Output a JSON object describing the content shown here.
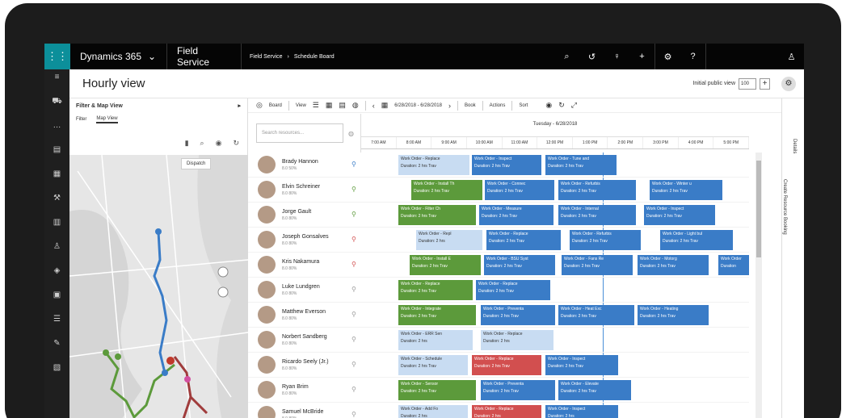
{
  "nav": {
    "brand": "Dynamics 365",
    "app": "Field Service",
    "breadcrumb": [
      "Field Service",
      "Schedule Board"
    ]
  },
  "page": {
    "title": "Hourly view",
    "zoom_label": "Initial public view",
    "zoom_value": "100"
  },
  "filter_panel": {
    "title": "Filter & Map View",
    "tabs": [
      "Filter",
      "Map View"
    ],
    "dispatch_label": "Dispatch"
  },
  "toolbar": {
    "board_label": "Board",
    "view_label": "View",
    "date_range": "6/28/2018 - 6/28/2018",
    "book_label": "Book",
    "actions_label": "Actions",
    "sort_label": "Sort"
  },
  "search": {
    "placeholder": "Search resources..."
  },
  "schedule": {
    "date_label": "Tuesday - 6/28/2018",
    "hours": [
      "7:00 AM",
      "8:00 AM",
      "9:00 AM",
      "10:00 AM",
      "11:00 AM",
      "12:00 PM",
      "1:00 PM",
      "2:00 PM",
      "3:00 PM",
      "4:00 PM",
      "5:00 PM"
    ]
  },
  "side": {
    "details": "Details",
    "create_booking": "Create Resource Booking"
  },
  "resources": [
    {
      "name": "Brady Hannon",
      "meta": "8.0  50%",
      "pin_color": "#3a7cc7",
      "bookings": [
        {
          "label": "Work Order - Replace",
          "duration": "Duration: 2 hrs Trav",
          "color": "light"
        },
        {
          "label": "Work Order - Inspect",
          "duration": "Duration: 2 hrs Trav",
          "color": "blue"
        },
        {
          "label": "Work Order - Tune and",
          "duration": "Duration: 2 hrs Trav",
          "color": "blue"
        }
      ]
    },
    {
      "name": "Elvin Schreiner",
      "meta": "8.0  80%",
      "pin_color": "#5c9a3b",
      "bookings": [
        {
          "label": "Work Order - Install Th",
          "duration": "Duration: 2 hrs Trav",
          "color": "green"
        },
        {
          "label": "Work Order - Connec",
          "duration": "Duration: 2 hrs Trav",
          "color": "blue"
        },
        {
          "label": "Work Order - Refurbis",
          "duration": "Duration: 2 hrs Trav",
          "color": "blue"
        },
        {
          "label": "Work Order - Winter u",
          "duration": "Duration: 2 hrs Trav",
          "color": "blue"
        }
      ]
    },
    {
      "name": "Jorge Gault",
      "meta": "8.0  80%",
      "pin_color": "#5c9a3b",
      "bookings": [
        {
          "label": "Work Order - Filter Ch",
          "duration": "Duration: 2 hrs Trav",
          "color": "green"
        },
        {
          "label": "Work Order - Measure",
          "duration": "Duration: 2 hrs Trav",
          "color": "blue"
        },
        {
          "label": "Work Order - Internal",
          "duration": "Duration: 2 hrs Trav",
          "color": "blue"
        },
        {
          "label": "Work Order - Inspect",
          "duration": "Duration: 2 hrs Trav",
          "color": "blue"
        }
      ]
    },
    {
      "name": "Joseph Gonsalves",
      "meta": "8.0  80%",
      "pin_color": "#d24f4f",
      "bookings": [
        {
          "label": "Work Order - Repl",
          "duration": "Duration: 2 hrs",
          "color": "light"
        },
        {
          "label": "Work Order - Replace",
          "duration": "Duration: 2 hrs Trav",
          "color": "blue"
        },
        {
          "label": "Work Order - Refurbis",
          "duration": "Duration: 2 hrs Trav",
          "color": "blue"
        },
        {
          "label": "Work Order - Light bul",
          "duration": "Duration: 2 hrs Trav",
          "color": "blue"
        }
      ]
    },
    {
      "name": "Kris Nakamura",
      "meta": "8.0  80%",
      "pin_color": "#d24f4f",
      "bookings": [
        {
          "label": "Work Order - Install E",
          "duration": "Duration: 2 hrs Trav",
          "color": "green"
        },
        {
          "label": "Work Order - BSU Syst",
          "duration": "Duration: 2 hrs Trav",
          "color": "blue"
        },
        {
          "label": "Work Order - Fans Re",
          "duration": "Duration: 2 hrs Trav",
          "color": "blue"
        },
        {
          "label": "Work Order - Motorg",
          "duration": "Duration: 2 hrs Trav",
          "color": "blue"
        },
        {
          "label": "Work Order",
          "duration": "Duration",
          "color": "blue"
        }
      ]
    },
    {
      "name": "Luke Lundgren",
      "meta": "8.0  80%",
      "pin_color": "#999999",
      "bookings": [
        {
          "label": "Work Order - Replace",
          "duration": "Duration: 2 hrs Trav",
          "color": "green"
        },
        {
          "label": "Work Order - Replace",
          "duration": "Duration: 2 hrs Trav",
          "color": "blue"
        }
      ]
    },
    {
      "name": "Matthew Everson",
      "meta": "8.0  80%",
      "pin_color": "#999999",
      "bookings": [
        {
          "label": "Work Order - Integrate",
          "duration": "Duration: 2 hrs Trav",
          "color": "green"
        },
        {
          "label": "Work Order - Preventa",
          "duration": "Duration: 2 hrs Trav",
          "color": "blue"
        },
        {
          "label": "Work Order - Heat Exc",
          "duration": "Duration: 2 hrs Trav",
          "color": "blue"
        },
        {
          "label": "Work Order - Heating",
          "duration": "Duration: 2 hrs Trav",
          "color": "blue"
        }
      ]
    },
    {
      "name": "Norbert Sandberg",
      "meta": "8.0  80%",
      "pin_color": "#999999",
      "bookings": [
        {
          "label": "Work Order - ERR Sen",
          "duration": "Duration: 2 hrs",
          "color": "light"
        },
        {
          "label": "Work Order - Replace",
          "duration": "Duration: 2 hrs",
          "color": "light"
        }
      ]
    },
    {
      "name": "Ricardo Seely (Jr.)",
      "meta": "8.0  80%",
      "pin_color": "#999999",
      "bookings": [
        {
          "label": "Work Order - Schedule",
          "duration": "Duration: 2 hrs Trav",
          "color": "light"
        },
        {
          "label": "Work Order - Replace",
          "duration": "Duration: 2 hrs Trav",
          "color": "red"
        },
        {
          "label": "Work Order - Inspect",
          "duration": "Duration: 2 hrs Trav",
          "color": "blue"
        }
      ]
    },
    {
      "name": "Ryan Brim",
      "meta": "8.0  80%",
      "pin_color": "#999999",
      "bookings": [
        {
          "label": "Work Order - Sensor",
          "duration": "Duration: 2 hrs Trav",
          "color": "green"
        },
        {
          "label": "Work Order - Preventa",
          "duration": "Duration: 2 hrs Trav",
          "color": "blue"
        },
        {
          "label": "Work Order - Elevate",
          "duration": "Duration: 2 hrs Trav",
          "color": "blue"
        }
      ]
    },
    {
      "name": "Samuel McBride",
      "meta": "8.0  80%",
      "pin_color": "#999999",
      "bookings": [
        {
          "label": "Work Order - Add Fo",
          "duration": "Duration: 2 hrs",
          "color": "light"
        },
        {
          "label": "Work Order - Replace",
          "duration": "Duration: 2 hrs",
          "color": "red"
        },
        {
          "label": "Work Order - Inspect",
          "duration": "Duration: 2 hrs",
          "color": "blue"
        }
      ]
    }
  ]
}
